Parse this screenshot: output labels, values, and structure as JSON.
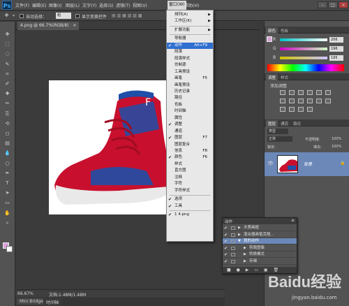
{
  "menubar": {
    "logo": "Ps",
    "items": [
      "文件(F)",
      "编辑(E)",
      "图像(I)",
      "图层(L)",
      "文字(Y)",
      "选择(S)",
      "滤镜(T)",
      "视图(V)",
      "窗口(W)",
      "帮助(H)"
    ],
    "open_item": "窗口(W)"
  },
  "optbar": {
    "auto_select": "自动选择：",
    "auto_select_value": "组",
    "show_transform": "显示变换控件"
  },
  "document": {
    "tab_label": "4.png @ 66.7%(RGB/8)",
    "close": "×"
  },
  "status": {
    "zoom": "66.67%",
    "doc_size": "文档:1.48M/1.48M"
  },
  "bottom_tabs": [
    "Mini Bridge",
    "时间轴"
  ],
  "window_menu": [
    {
      "label": "排列(A)",
      "submenu": true
    },
    {
      "label": "工作区(K)",
      "submenu": true
    },
    {
      "sep": true
    },
    {
      "label": "扩展功能",
      "submenu": true
    },
    {
      "sep": true
    },
    {
      "label": "导航器"
    },
    {
      "label": "动作",
      "shortcut": "Alt+F9",
      "checked": true,
      "highlight": true
    },
    {
      "label": "段落"
    },
    {
      "label": "段落样式"
    },
    {
      "label": "仿制源"
    },
    {
      "label": "工具预设"
    },
    {
      "label": "画笔",
      "shortcut": "F5"
    },
    {
      "label": "画笔预设"
    },
    {
      "label": "历史记录"
    },
    {
      "label": "路径"
    },
    {
      "label": "色板"
    },
    {
      "label": "时间轴"
    },
    {
      "label": "属性"
    },
    {
      "label": "调整",
      "checked": true
    },
    {
      "label": "通道"
    },
    {
      "label": "图层",
      "shortcut": "F7",
      "checked": true
    },
    {
      "label": "图层复合"
    },
    {
      "label": "信息",
      "shortcut": "F8"
    },
    {
      "label": "颜色",
      "shortcut": "F6",
      "checked": true
    },
    {
      "label": "样式"
    },
    {
      "label": "直方图"
    },
    {
      "label": "注释"
    },
    {
      "label": "字符"
    },
    {
      "label": "字符样式"
    },
    {
      "sep": true
    },
    {
      "label": "选项",
      "checked": true
    },
    {
      "label": "工具",
      "checked": true
    },
    {
      "sep": true
    },
    {
      "label": "1 4.png",
      "checked": true
    }
  ],
  "color_panel": {
    "tabs": [
      "颜色",
      "色板"
    ],
    "r_label": "R",
    "g_label": "G",
    "b_label": "B",
    "r": "206",
    "g": "196",
    "b": "195"
  },
  "adjust_panel": {
    "tabs": [
      "调整",
      "样式"
    ],
    "title": "添加调整"
  },
  "layers_panel": {
    "tabs": [
      "图层",
      "通道",
      "路径"
    ],
    "kind": "类型",
    "mode": "正常",
    "opacity_label": "不透明度:",
    "opacity": "100%",
    "lock_label": "锁定:",
    "fill_label": "填充:",
    "fill": "100%",
    "layer_name": "背景"
  },
  "actions_panel": {
    "title": "动作",
    "rows": [
      {
        "label": "木质画框",
        "checked": true,
        "indent": 0
      },
      {
        "label": "混合器画笔克隆...",
        "checked": true,
        "indent": 0
      },
      {
        "label": "我的动作",
        "checked": true,
        "indent": 0,
        "highlight": true,
        "expanded": true
      },
      {
        "label": "剪裁图像",
        "checked": true,
        "indent": 1
      },
      {
        "label": "转换模式",
        "checked": true,
        "indent": 1
      },
      {
        "label": "存储",
        "checked": true,
        "indent": 1
      }
    ]
  },
  "watermark": {
    "brand": "Baidu经验",
    "url": "jingyan.baidu.com"
  },
  "colors": {
    "accent": "#2f6fcf",
    "fg": "#d7a1d6",
    "shoe_red": "#c8102e",
    "shoe_blue": "#1f4fa8"
  }
}
